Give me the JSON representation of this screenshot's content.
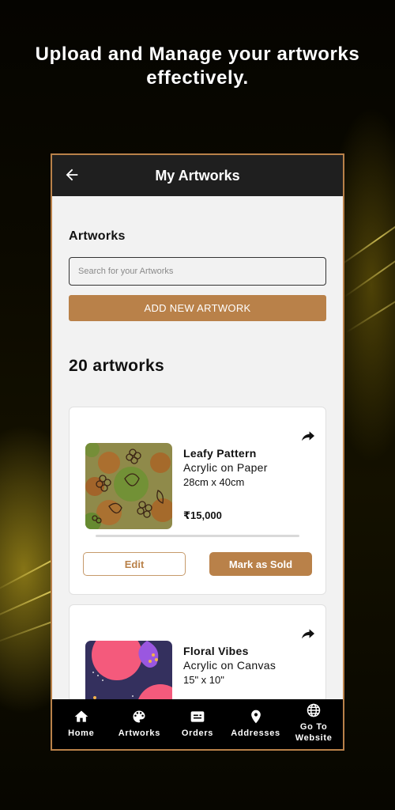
{
  "promo": {
    "headline_line1": "Upload and Manage your artworks",
    "headline_line2": "effectively."
  },
  "appbar": {
    "back_icon": "arrow-left-icon",
    "title": "My Artworks"
  },
  "main": {
    "section_title": "Artworks",
    "search": {
      "placeholder": "Search for your Artworks",
      "value": ""
    },
    "add_button_label": "ADD NEW ARTWORK",
    "count_label": "20 artworks"
  },
  "artworks": [
    {
      "title": "Leafy Pattern",
      "medium": "Acrylic on Paper",
      "size": "28cm x 40cm",
      "price": "₹15,000",
      "edit_label": "Edit",
      "sold_label": "Mark as Sold",
      "share_icon": "share-icon"
    },
    {
      "title": "Floral Vibes",
      "medium": "Acrylic on Canvas",
      "size": "15\" x 10\"",
      "share_icon": "share-icon"
    }
  ],
  "bottom_nav": [
    {
      "label": "Home",
      "icon": "home-icon"
    },
    {
      "label": "Artworks",
      "icon": "palette-icon"
    },
    {
      "label": "Orders",
      "icon": "orders-icon"
    },
    {
      "label": "Addresses",
      "icon": "location-pin-icon"
    },
    {
      "label": "Go To Website",
      "label_line1": "Go To",
      "label_line2": "Website",
      "icon": "globe-icon"
    }
  ],
  "colors": {
    "accent": "#b98149",
    "appbar": "#1f1f1f",
    "background": "#f2f2f2",
    "nav": "#000000"
  }
}
